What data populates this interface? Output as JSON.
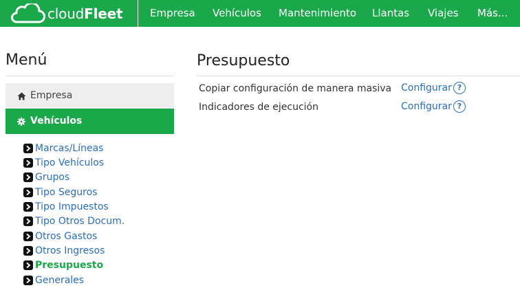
{
  "app": {
    "logo_light": "cloud",
    "logo_bold": "Fleet",
    "colors": {
      "brand_green": "#1ba84a",
      "link_blue": "#2a6ebb"
    }
  },
  "nav": {
    "items": [
      "Empresa",
      "Vehículos",
      "Mantenimiento",
      "Llantas",
      "Viajes",
      "Más..."
    ]
  },
  "sidebar": {
    "title": "Menú",
    "sections": [
      {
        "label": "Empresa",
        "icon": "home-icon"
      },
      {
        "label": "Vehículos",
        "icon": "gear-icon"
      }
    ],
    "items": [
      {
        "label": "Marcas/Líneas"
      },
      {
        "label": "Tipo Vehículos"
      },
      {
        "label": "Grupos"
      },
      {
        "label": "Tipo Seguros"
      },
      {
        "label": "Tipo Impuestos"
      },
      {
        "label": "Tipo Otros Docum."
      },
      {
        "label": "Otros Gastos"
      },
      {
        "label": "Otros Ingresos"
      },
      {
        "label": "Presupuesto"
      },
      {
        "label": "Generales"
      }
    ],
    "active_item": "Presupuesto"
  },
  "content": {
    "title": "Presupuesto",
    "rows": [
      {
        "label": "Copiar configuración de manera masiva",
        "action": "Configurar",
        "help": "?"
      },
      {
        "label": "Indicadores de ejecución",
        "action": "Configurar",
        "help": "?"
      }
    ]
  }
}
